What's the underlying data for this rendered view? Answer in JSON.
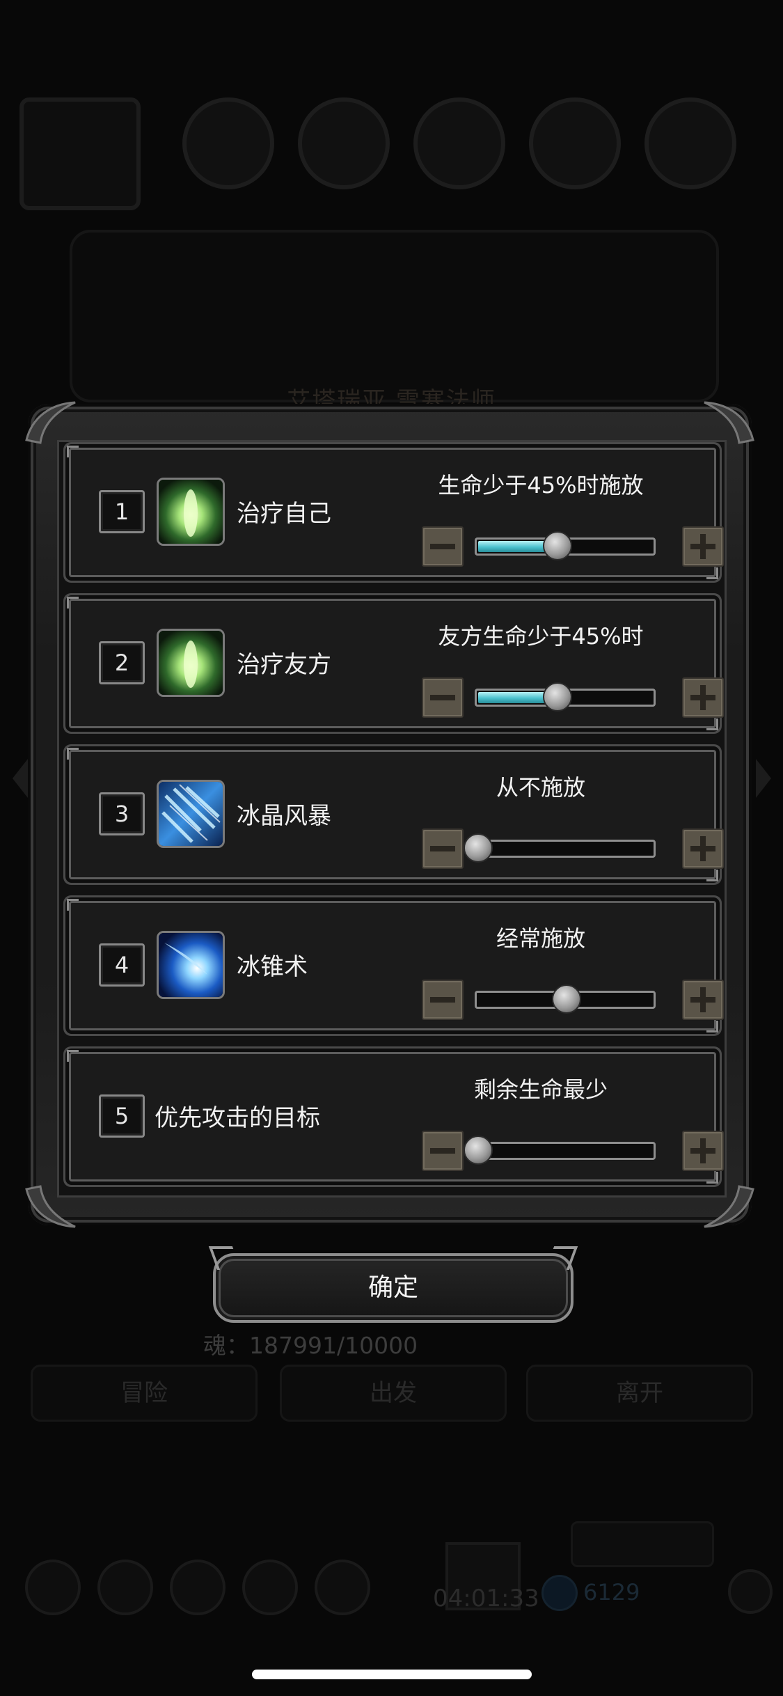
{
  "background": {
    "title": "艾塔瑞亚 雪寒法师",
    "resource_text": "魂：187991/10000",
    "actions": [
      "冒险",
      "出发",
      "离开"
    ],
    "timer": "04:01:33",
    "gem_count": "6129"
  },
  "skills": [
    {
      "number": "1",
      "name": "治疗自己",
      "condition": "生命少于45%时施放",
      "icon": "green-heal-icon",
      "has_icon": true,
      "slider_fraction": 0.45,
      "filled": true
    },
    {
      "number": "2",
      "name": "治疗友方",
      "condition": "友方生命少于45%时",
      "icon": "green-heal-icon",
      "has_icon": true,
      "slider_fraction": 0.45,
      "filled": true
    },
    {
      "number": "3",
      "name": "冰晶风暴",
      "condition": "从不施放",
      "icon": "ice-storm-icon",
      "has_icon": true,
      "slider_fraction": 0.0,
      "filled": false
    },
    {
      "number": "4",
      "name": "冰锥术",
      "condition": "经常施放",
      "icon": "ice-cone-icon",
      "has_icon": true,
      "slider_fraction": 0.5,
      "filled": false
    },
    {
      "number": "5",
      "name": "优先攻击的目标",
      "condition": "剩余生命最少",
      "icon": "",
      "has_icon": false,
      "slider_fraction": 0.0,
      "filled": false
    }
  ],
  "confirm_label": "确定",
  "colors": {
    "slider_fill": "#4cc2cf",
    "step_button": "#5a5448",
    "panel": "#1b1b1b"
  }
}
